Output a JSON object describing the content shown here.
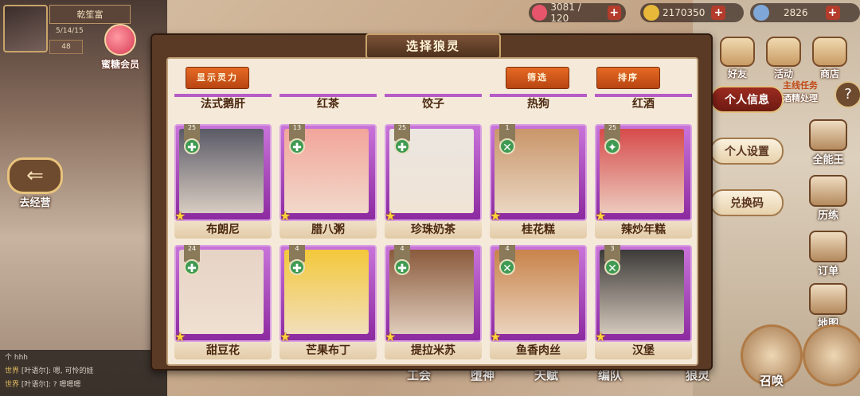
{
  "resources": {
    "stamina": "3081 / 120",
    "coins": "2170350",
    "crystals": "2826"
  },
  "player": {
    "name": "乾笙富",
    "info": "5/14/15",
    "level": "48",
    "vip_label": "蜜糖会员"
  },
  "left": {
    "go_shop_label": "去经营"
  },
  "chat": {
    "header": "个 hhh",
    "lines": [
      {
        "tag": "世界",
        "text": "[叶语尔]: 嗯, 可怜的娃"
      },
      {
        "tag": "世界",
        "text": "[叶语尔]: ? 嗯嗯嗯"
      }
    ]
  },
  "right_menu": {
    "top_icons": [
      "好友",
      "活动",
      "商店"
    ],
    "quest_title": "主线任务",
    "quest_sub": "酒精处理",
    "pills": [
      "个人信息",
      "个人设置",
      "兑换码"
    ],
    "side": [
      "全能王",
      "历练",
      "订单",
      "地图"
    ],
    "bottom": [
      "工会",
      "堕神",
      "天赋",
      "编队",
      "狼灵"
    ],
    "circles": [
      "召唤",
      ""
    ]
  },
  "dialog": {
    "title": "选择狼灵",
    "show_power_label": "显示灵力",
    "filter_label": "筛选",
    "sort_label": "排序",
    "top_row": [
      "法式鹅肝",
      "红茶",
      "饺子",
      "热狗",
      "红酒"
    ],
    "cards": [
      {
        "name": "布朗尼",
        "level": "25",
        "badge": "✚",
        "portrait": "#5a5a66"
      },
      {
        "name": "腊八粥",
        "level": "13",
        "badge": "✚",
        "portrait": "#f2a59a"
      },
      {
        "name": "珍珠奶茶",
        "level": "25",
        "badge": "✚",
        "portrait": "#ebe6e0"
      },
      {
        "name": "桂花糕",
        "level": "1",
        "badge": "✕",
        "portrait": "#c9966a"
      },
      {
        "name": "辣炒年糕",
        "level": "25",
        "badge": "✦",
        "portrait": "#d64b4b"
      },
      {
        "name": "甜豆花",
        "level": "24",
        "badge": "✚",
        "portrait": "#e6d3c6"
      },
      {
        "name": "芒果布丁",
        "level": "4",
        "badge": "✚",
        "portrait": "#f3c83a"
      },
      {
        "name": "提拉米苏",
        "level": "4",
        "badge": "✚",
        "portrait": "#8a5a3c"
      },
      {
        "name": "鱼香肉丝",
        "level": "4",
        "badge": "✕",
        "portrait": "#c8834a"
      },
      {
        "name": "汉堡",
        "level": "3",
        "badge": "✕",
        "portrait": "#3c3a38"
      }
    ]
  },
  "colors": {
    "frame": "#c974da",
    "button_orange": "#e66a24",
    "dialog_brown": "#5a3a24"
  }
}
